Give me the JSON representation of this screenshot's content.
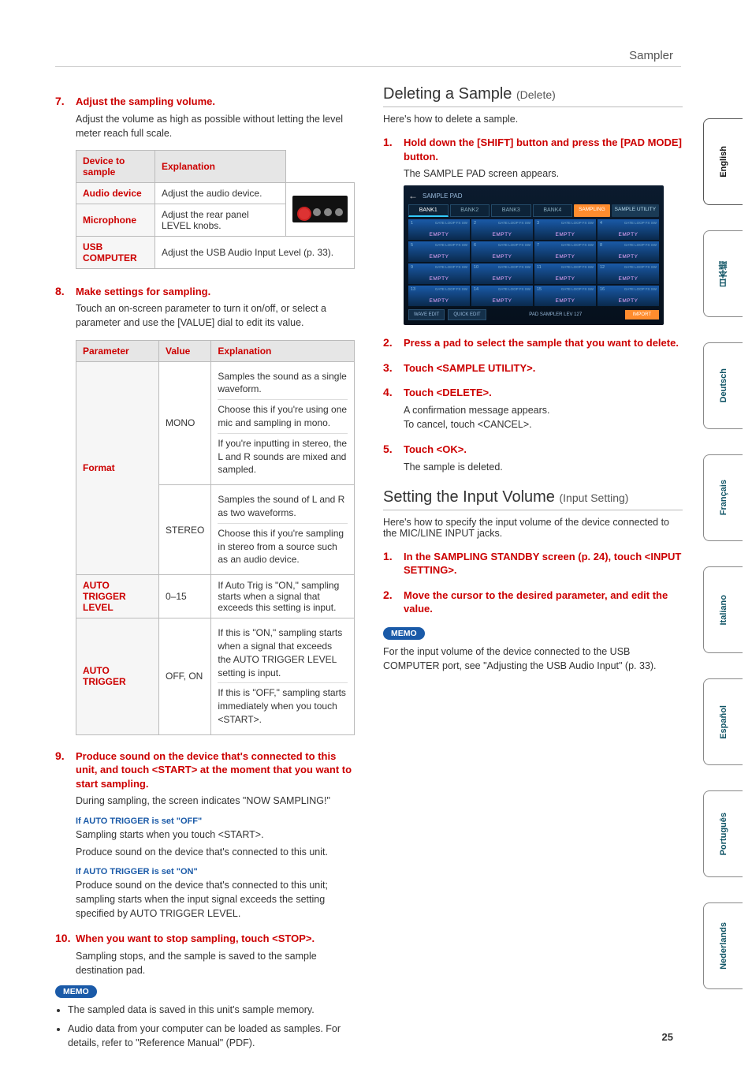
{
  "header": {
    "section": "Sampler"
  },
  "tabs": [
    "English",
    "日本語",
    "Deutsch",
    "Français",
    "Italiano",
    "Español",
    "Português",
    "Nederlands"
  ],
  "left": {
    "step7": {
      "num": "7.",
      "title": "Adjust the sampling volume.",
      "body": "Adjust the volume as high as possible without letting the level meter reach full scale."
    },
    "table1": {
      "head": [
        "Device to sample",
        "Explanation"
      ],
      "rows": [
        {
          "k": "Audio device",
          "v": "Adjust the audio device."
        },
        {
          "k": "Microphone",
          "v": "Adjust the rear panel LEVEL knobs."
        },
        {
          "k": "USB COMPUTER",
          "v": "Adjust the USB Audio Input Level (p. 33)."
        }
      ]
    },
    "step8": {
      "num": "8.",
      "title": "Make settings for sampling.",
      "body": "Touch an on-screen parameter to turn it on/off, or select a parameter and use the [VALUE] dial to edit its value."
    },
    "table2": {
      "head": [
        "Parameter",
        "Value",
        "Explanation"
      ],
      "rows": {
        "format": {
          "param": "Format",
          "mono": {
            "val": "MONO",
            "e1": "Samples the sound as a single waveform.",
            "e2": "Choose this if you're using one mic and sampling in mono.",
            "e3": "If you're inputting in stereo, the L and R sounds are mixed and sampled."
          },
          "stereo": {
            "val": "STEREO",
            "e1": "Samples the sound of L and R as two waveforms.",
            "e2": "Choose this if you're sampling in stereo from a source such as an audio device."
          }
        },
        "level": {
          "param": "AUTO TRIGGER LEVEL",
          "val": "0–15",
          "e": "If Auto Trig is \"ON,\" sampling starts when a signal that exceeds this setting is input."
        },
        "trigger": {
          "param": "AUTO TRIGGER",
          "val": "OFF, ON",
          "e1": "If this is \"ON,\" sampling starts when a signal that exceeds the AUTO TRIGGER LEVEL setting is input.",
          "e2": "If this is \"OFF,\" sampling starts immediately when you touch <START>."
        }
      }
    },
    "step9": {
      "num": "9.",
      "title": "Produce sound on the device that's connected to this unit, and touch <START> at the moment that you want to start sampling.",
      "body": "During sampling, the screen indicates \"NOW SAMPLING!\""
    },
    "sub_off": {
      "h": "If AUTO TRIGGER is set \"OFF\"",
      "l1": "Sampling starts when you touch <START>.",
      "l2": "Produce sound on the device that's connected to this unit."
    },
    "sub_on": {
      "h": "If AUTO TRIGGER is set \"ON\"",
      "l1": "Produce sound on the device that's connected to this unit; sampling starts when the input signal exceeds the setting specified by AUTO TRIGGER LEVEL."
    },
    "step10": {
      "num": "10.",
      "title": "When you want to stop sampling, touch <STOP>.",
      "body": "Sampling stops, and the sample is saved to the sample destination pad."
    },
    "memo": {
      "label": "MEMO",
      "items": [
        "The sampled data is saved in this unit's sample memory.",
        "Audio data from your computer can be loaded as samples. For details, refer to \"Reference Manual\" (PDF)."
      ]
    }
  },
  "right": {
    "delete": {
      "head_big": "Deleting a Sample ",
      "head_small": "(Delete)",
      "intro": "Here's how to delete a sample.",
      "s1": {
        "num": "1.",
        "title": "Hold down the [SHIFT] button and press the [PAD MODE] button.",
        "body": "The SAMPLE PAD screen appears."
      },
      "s2": {
        "num": "2.",
        "title": "Press a pad to select the sample that you want to delete."
      },
      "s3": {
        "num": "3.",
        "title": "Touch <SAMPLE UTILITY>."
      },
      "s4": {
        "num": "4.",
        "title": "Touch <DELETE>.",
        "body1": "A confirmation message appears.",
        "body2": "To cancel, touch <CANCEL>."
      },
      "s5": {
        "num": "5.",
        "title": "Touch <OK>.",
        "body": "The sample is deleted."
      }
    },
    "padshot": {
      "title": "SAMPLE PAD",
      "banks": [
        "BANK1",
        "BANK2",
        "BANK3",
        "BANK4"
      ],
      "sampling": "SAMPLING",
      "utility": "SAMPLE UTILITY",
      "tags": "GATE  LOOP  FX SW",
      "empty": "EMPTY",
      "wave": "WAVE EDIT",
      "quick": "QUICK EDIT",
      "level": "PAD SAMPLER LEV\n127",
      "import": "IMPORT"
    },
    "input": {
      "head_big": "Setting the Input Volume ",
      "head_small": "(Input Setting)",
      "intro": "Here's how to specify the input volume of the device connected to the MIC/LINE INPUT jacks.",
      "s1": {
        "num": "1.",
        "title": "In the SAMPLING STANDBY screen (p. 24), touch <INPUT SETTING>."
      },
      "s2": {
        "num": "2.",
        "title": "Move the cursor to the desired parameter, and edit the value."
      },
      "memo": {
        "label": "MEMO",
        "text": "For the input volume of the device connected to the USB COMPUTER port, see \"Adjusting the USB Audio Input\" (p. 33)."
      }
    }
  },
  "pagenum": "25"
}
